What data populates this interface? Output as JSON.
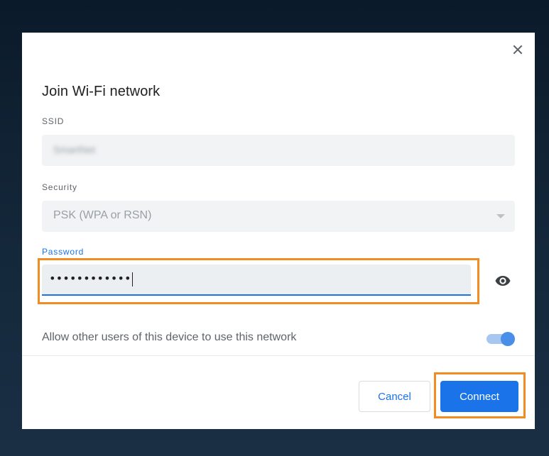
{
  "dialog": {
    "title": "Join Wi-Fi network",
    "close_icon": "close-icon",
    "ssid": {
      "label": "SSID",
      "value": "SmartNet"
    },
    "security": {
      "label": "Security",
      "value": "PSK (WPA or RSN)",
      "icon": "chevron-down-icon"
    },
    "password": {
      "label": "Password",
      "value": "••••••••••••",
      "reveal_icon": "eye-icon"
    },
    "share_network": {
      "label": "Allow other users of this device to use this network",
      "enabled": true
    },
    "buttons": {
      "cancel": "Cancel",
      "connect": "Connect"
    }
  },
  "colors": {
    "accent": "#1a73e8",
    "highlight": "#f08c21",
    "backdrop": "#0b1a2a"
  }
}
